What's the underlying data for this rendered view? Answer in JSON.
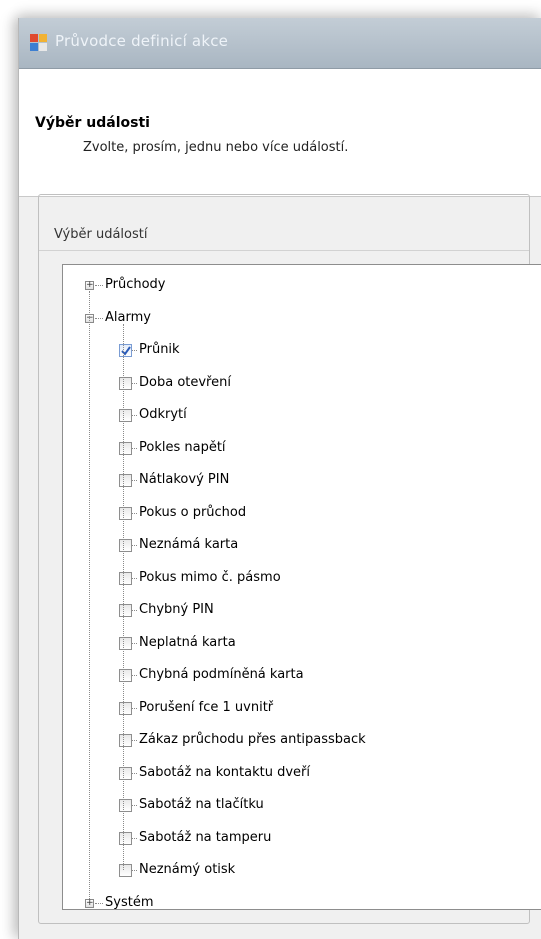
{
  "window": {
    "title": "Průvodce definicí akce"
  },
  "header": {
    "title": "Výběr události",
    "subtitle": "Zvolte, prosím, jednu nebo více událostí."
  },
  "group": {
    "label": "Výběr událostí"
  },
  "tree": {
    "roots": [
      {
        "label": "Průchody",
        "expanded": false
      },
      {
        "label": "Alarmy",
        "expanded": true
      },
      {
        "label": "Systém",
        "expanded": false
      }
    ],
    "alarm_items": [
      {
        "label": "Průnik",
        "checked": true
      },
      {
        "label": "Doba otevření",
        "checked": false
      },
      {
        "label": "Odkrytí",
        "checked": false
      },
      {
        "label": "Pokles napětí",
        "checked": false
      },
      {
        "label": "Nátlakový PIN",
        "checked": false
      },
      {
        "label": "Pokus o průchod",
        "checked": false
      },
      {
        "label": "Neznámá karta",
        "checked": false
      },
      {
        "label": "Pokus mimo č. pásmo",
        "checked": false
      },
      {
        "label": "Chybný PIN",
        "checked": false
      },
      {
        "label": "Neplatná karta",
        "checked": false
      },
      {
        "label": "Chybná podmíněná karta",
        "checked": false
      },
      {
        "label": "Porušení fce 1 uvnitř",
        "checked": false
      },
      {
        "label": "Zákaz průchodu přes antipassback",
        "checked": false
      },
      {
        "label": "Sabotáž na kontaktu dveří",
        "checked": false
      },
      {
        "label": "Sabotáž na tlačítku",
        "checked": false
      },
      {
        "label": "Sabotáž na tamperu",
        "checked": false
      },
      {
        "label": "Neznámý otisk",
        "checked": false
      }
    ]
  },
  "colors": {
    "titlebar": "#b3bfca",
    "check": "#2a5bb8"
  },
  "icons": {
    "app": "wizard-app-icon",
    "expand": "plus-expander-icon",
    "collapse": "minus-expander-icon",
    "checkbox": "checkbox-icon"
  }
}
